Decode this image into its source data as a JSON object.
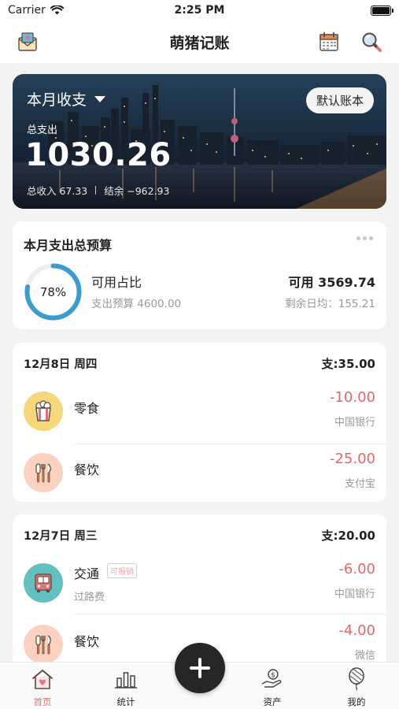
{
  "status_bar": {
    "carrier": "Carrier",
    "time": "2:25 PM",
    "battery_level": 1.0
  },
  "nav": {
    "title": "萌猪记账",
    "left_icon": "mail-heart-icon",
    "right_icons": [
      "calendar-icon",
      "search-icon"
    ]
  },
  "banner": {
    "period": "本月收支",
    "book_button": "默认账本",
    "expense_label": "总支出",
    "expense_value": "1030.26",
    "income_text": "总收入 67.33",
    "balance_text": "结余 −962.93"
  },
  "budget": {
    "title": "本月支出总预算",
    "percent_text": "78%",
    "percent": 0.78,
    "available_label": "可用占比",
    "budget_label": "支出预算 4600.00",
    "available_value": "可用 3569.74",
    "daily_avg": "剩余日均：155.21"
  },
  "days": [
    {
      "date": "12月8日  周四",
      "total": "支:35.00",
      "items": [
        {
          "category": "零食",
          "note": "",
          "tag": "",
          "amount": "-10.00",
          "account": "中国银行",
          "icon": "popcorn-icon",
          "icon_bg": "#f6d87a"
        },
        {
          "category": "餐饮",
          "note": "",
          "tag": "",
          "amount": "-25.00",
          "account": "支付宝",
          "icon": "utensils-icon",
          "icon_bg": "#fbd2c0"
        }
      ]
    },
    {
      "date": "12月7日  周三",
      "total": "支:20.00",
      "items": [
        {
          "category": "交通",
          "note": "过路费",
          "tag": "可报销",
          "amount": "-6.00",
          "account": "中国银行",
          "icon": "bus-icon",
          "icon_bg": "#63c0c0"
        },
        {
          "category": "餐饮",
          "note": "",
          "tag": "",
          "amount": "-4.00",
          "account": "微信",
          "icon": "utensils-icon",
          "icon_bg": "#fbd2c0"
        }
      ]
    }
  ],
  "tabs": [
    {
      "label": "首页",
      "icon": "home-heart-icon",
      "active": true
    },
    {
      "label": "统计",
      "icon": "bar-chart-icon",
      "active": false
    },
    {
      "label": "资产",
      "icon": "money-hand-icon",
      "active": false
    },
    {
      "label": "我的",
      "icon": "balloon-icon",
      "active": false
    }
  ],
  "fab": {
    "icon": "plus-icon"
  },
  "colors": {
    "accent": "#e5727b",
    "ring": "#3a9cd0",
    "expense": "#e66767"
  }
}
